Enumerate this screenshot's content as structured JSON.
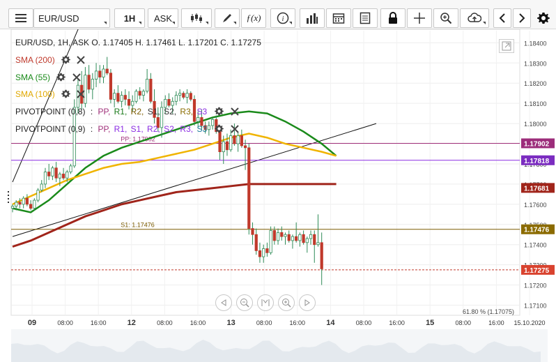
{
  "toolbar": {
    "symbol": "EUR/USD",
    "timeframe": "1H",
    "price_type": "ASK"
  },
  "header": {
    "ohlc": "EUR/USD, 1H, ASK   O. 1.17405 H. 1.17461 L. 1.17201 C. 1.17275"
  },
  "indicators": [
    {
      "label": "SMA (200)",
      "color": "#c0392b"
    },
    {
      "label": "SMA (55)",
      "color": "#1a8a1a"
    },
    {
      "label": "SMA (100)",
      "color": "#f0b400"
    }
  ],
  "pivots": [
    {
      "label": "PIVOTPOINT (0,8)",
      "items": [
        "PP,",
        "R1,",
        "R2,",
        "S1,",
        "S2,",
        "R3,",
        "S3"
      ]
    },
    {
      "label": "PIVOTPOINT (0,9)",
      "items": [
        "PP,",
        "R1,",
        "S1,",
        "R2,",
        "S2,",
        "R3,",
        "S3"
      ]
    }
  ],
  "chart_data": {
    "type": "line",
    "y_ticks": [
      1.184,
      1.183,
      1.182,
      1.181,
      1.18,
      1.179,
      1.178,
      1.177,
      1.176,
      1.175,
      1.174,
      1.173,
      1.172,
      1.171
    ],
    "y_tick_labels": [
      "1.18400",
      "1.18300",
      "1.18200",
      "1.18100",
      "1.18000",
      "1.17900",
      "1.17800",
      "1.17700",
      "1.17600",
      "1.17500",
      "1.17400",
      "1.17300",
      "1.17200",
      "1.17100"
    ],
    "ylim": [
      1.1705,
      1.1846
    ],
    "x_tick_labels": [
      "09",
      "08:00",
      "16:00",
      "12",
      "08:00",
      "16:00",
      "13",
      "08:00",
      "16:00",
      "14",
      "08:00",
      "16:00",
      "15",
      "08:00",
      "16:00",
      "15.10.2020"
    ],
    "x_tick_bold": [
      "09",
      "12",
      "13",
      "14",
      "15"
    ],
    "n_bars": 100,
    "candles": [
      [
        1.1758,
        1.176,
        1.1756,
        1.1759
      ],
      [
        1.1759,
        1.1762,
        1.1757,
        1.1761
      ],
      [
        1.1761,
        1.1763,
        1.1758,
        1.176
      ],
      [
        1.176,
        1.1764,
        1.1758,
        1.1763
      ],
      [
        1.1763,
        1.1765,
        1.1759,
        1.176
      ],
      [
        1.176,
        1.1762,
        1.1757,
        1.1758
      ],
      [
        1.1758,
        1.1763,
        1.1757,
        1.1762
      ],
      [
        1.1762,
        1.1768,
        1.1761,
        1.1767
      ],
      [
        1.1767,
        1.1772,
        1.1766,
        1.177
      ],
      [
        1.177,
        1.1778,
        1.1768,
        1.1776
      ],
      [
        1.1776,
        1.178,
        1.1772,
        1.1774
      ],
      [
        1.1774,
        1.1779,
        1.1772,
        1.1778
      ],
      [
        1.1778,
        1.1781,
        1.1771,
        1.1773
      ],
      [
        1.1773,
        1.1776,
        1.1769,
        1.1775
      ],
      [
        1.1775,
        1.1778,
        1.1772,
        1.1773
      ],
      [
        1.1773,
        1.1777,
        1.1771,
        1.1776
      ],
      [
        1.1776,
        1.178,
        1.1775,
        1.1779
      ],
      [
        1.1779,
        1.1812,
        1.1778,
        1.1808
      ],
      [
        1.1808,
        1.1822,
        1.1805,
        1.1819
      ],
      [
        1.1819,
        1.1826,
        1.1807,
        1.181
      ],
      [
        1.181,
        1.1828,
        1.1808,
        1.1824
      ],
      [
        1.1824,
        1.1829,
        1.1815,
        1.1817
      ],
      [
        1.1817,
        1.1825,
        1.1812,
        1.1822
      ],
      [
        1.1822,
        1.183,
        1.1818,
        1.1826
      ],
      [
        1.1826,
        1.1829,
        1.182,
        1.1823
      ],
      [
        1.1823,
        1.1829,
        1.182,
        1.1827
      ],
      [
        1.1827,
        1.1833,
        1.1824,
        1.1825
      ],
      [
        1.1825,
        1.1827,
        1.181,
        1.1812
      ],
      [
        1.1812,
        1.1817,
        1.1808,
        1.1815
      ],
      [
        1.1815,
        1.1819,
        1.181,
        1.1811
      ],
      [
        1.1811,
        1.1816,
        1.1808,
        1.1814
      ],
      [
        1.1814,
        1.1817,
        1.1809,
        1.1812
      ],
      [
        1.1812,
        1.1816,
        1.1807,
        1.1809
      ],
      [
        1.1809,
        1.1814,
        1.1806,
        1.1811
      ],
      [
        1.1811,
        1.1817,
        1.181,
        1.1816
      ],
      [
        1.1816,
        1.1818,
        1.1812,
        1.1814
      ],
      [
        1.1814,
        1.1817,
        1.1811,
        1.1816
      ],
      [
        1.1816,
        1.1827,
        1.1815,
        1.1822
      ],
      [
        1.1822,
        1.1825,
        1.181,
        1.1811
      ],
      [
        1.1811,
        1.1817,
        1.18,
        1.1803
      ],
      [
        1.1803,
        1.1808,
        1.1796,
        1.1798
      ],
      [
        1.1798,
        1.1811,
        1.1793,
        1.1808
      ],
      [
        1.1808,
        1.1814,
        1.1805,
        1.1812
      ],
      [
        1.1812,
        1.1815,
        1.1808,
        1.1809
      ],
      [
        1.1809,
        1.1813,
        1.1805,
        1.1811
      ],
      [
        1.1811,
        1.1816,
        1.1809,
        1.1814
      ],
      [
        1.1814,
        1.1817,
        1.1811,
        1.1815
      ],
      [
        1.1815,
        1.1816,
        1.1812,
        1.1813
      ],
      [
        1.1813,
        1.1817,
        1.181,
        1.1815
      ],
      [
        1.1815,
        1.1816,
        1.1811,
        1.1812
      ],
      [
        1.1812,
        1.1814,
        1.1799,
        1.1801
      ],
      [
        1.1801,
        1.1806,
        1.1798,
        1.1803
      ],
      [
        1.1803,
        1.1807,
        1.1797,
        1.1799
      ],
      [
        1.1799,
        1.1801,
        1.1795,
        1.1797
      ],
      [
        1.1797,
        1.1801,
        1.1794,
        1.1799
      ],
      [
        1.1799,
        1.1803,
        1.1797,
        1.1802
      ],
      [
        1.1802,
        1.1804,
        1.1795,
        1.1796
      ],
      [
        1.1796,
        1.1799,
        1.1782,
        1.1786
      ],
      [
        1.1786,
        1.1794,
        1.178,
        1.1791
      ],
      [
        1.1791,
        1.1795,
        1.1784,
        1.1787
      ],
      [
        1.1787,
        1.1797,
        1.1786,
        1.1794
      ],
      [
        1.1794,
        1.18,
        1.1789,
        1.179
      ],
      [
        1.179,
        1.1796,
        1.1786,
        1.1794
      ],
      [
        1.1794,
        1.1797,
        1.1788,
        1.1789
      ],
      [
        1.1789,
        1.1792,
        1.1777,
        1.1788
      ],
      [
        1.1788,
        1.179,
        1.1745,
        1.1748
      ],
      [
        1.1748,
        1.1751,
        1.174,
        1.1745
      ],
      [
        1.1745,
        1.1748,
        1.1735,
        1.1737
      ],
      [
        1.1737,
        1.1741,
        1.1731,
        1.1734
      ],
      [
        1.1734,
        1.174,
        1.1731,
        1.1738
      ],
      [
        1.1738,
        1.1741,
        1.1734,
        1.1736
      ],
      [
        1.1736,
        1.1749,
        1.1735,
        1.1747
      ],
      [
        1.1747,
        1.1749,
        1.174,
        1.1742
      ],
      [
        1.1742,
        1.1748,
        1.174,
        1.1746
      ],
      [
        1.1746,
        1.1749,
        1.1742,
        1.1744
      ],
      [
        1.1744,
        1.1746,
        1.174,
        1.1745
      ],
      [
        1.1745,
        1.1747,
        1.1741,
        1.1742
      ],
      [
        1.1742,
        1.1745,
        1.1738,
        1.1744
      ],
      [
        1.1744,
        1.1751,
        1.1741,
        1.1742
      ],
      [
        1.1742,
        1.1746,
        1.1739,
        1.1745
      ],
      [
        1.1745,
        1.1747,
        1.174,
        1.1741
      ],
      [
        1.1741,
        1.1744,
        1.1736,
        1.1743
      ],
      [
        1.1743,
        1.1747,
        1.174,
        1.1745
      ],
      [
        1.1745,
        1.1747,
        1.1731,
        1.174
      ],
      [
        1.174,
        1.1755,
        1.1739,
        1.1741
      ],
      [
        1.1741,
        1.1746,
        1.172,
        1.1728
      ]
    ],
    "series": [
      {
        "name": "SMA (55)",
        "values": [
          [
            0,
            1.1758
          ],
          [
            5,
            1.1756
          ],
          [
            10,
            1.1762
          ],
          [
            15,
            1.177
          ],
          [
            20,
            1.1778
          ],
          [
            25,
            1.1784
          ],
          [
            30,
            1.1788
          ],
          [
            35,
            1.1791
          ],
          [
            40,
            1.1794
          ],
          [
            45,
            1.1797
          ],
          [
            50,
            1.18
          ],
          [
            55,
            1.1803
          ],
          [
            60,
            1.1805
          ],
          [
            65,
            1.1806
          ],
          [
            70,
            1.1805
          ],
          [
            75,
            1.1801
          ],
          [
            80,
            1.1796
          ],
          [
            85,
            1.179
          ],
          [
            89,
            1.1784
          ]
        ]
      },
      {
        "name": "SMA (100)",
        "values": [
          [
            0,
            1.176
          ],
          [
            5,
            1.1764
          ],
          [
            10,
            1.1768
          ],
          [
            15,
            1.1772
          ],
          [
            20,
            1.1775
          ],
          [
            25,
            1.1778
          ],
          [
            30,
            1.178
          ],
          [
            35,
            1.1781
          ],
          [
            40,
            1.1783
          ],
          [
            45,
            1.1785
          ],
          [
            50,
            1.1787
          ],
          [
            55,
            1.179
          ],
          [
            60,
            1.1793
          ],
          [
            65,
            1.1795
          ],
          [
            70,
            1.1793
          ],
          [
            75,
            1.179
          ],
          [
            80,
            1.1788
          ],
          [
            85,
            1.1786
          ],
          [
            89,
            1.1784
          ]
        ]
      },
      {
        "name": "SMA (200)",
        "values": [
          [
            0,
            1.1739
          ],
          [
            5,
            1.1742
          ],
          [
            10,
            1.1746
          ],
          [
            15,
            1.175
          ],
          [
            20,
            1.1754
          ],
          [
            25,
            1.1757
          ],
          [
            30,
            1.176
          ],
          [
            35,
            1.1762
          ],
          [
            40,
            1.1764
          ],
          [
            45,
            1.1766
          ],
          [
            50,
            1.1767
          ],
          [
            55,
            1.1768
          ],
          [
            60,
            1.1769
          ],
          [
            65,
            1.177
          ],
          [
            70,
            1.177
          ],
          [
            75,
            1.177
          ],
          [
            80,
            1.177
          ],
          [
            85,
            1.177
          ],
          [
            89,
            1.177
          ]
        ]
      }
    ],
    "trendlines": [
      {
        "from": [
          0,
          1.1744
        ],
        "to": [
          100,
          1.18
        ]
      },
      {
        "from": [
          0,
          1.1771
        ],
        "to": [
          20,
          1.1855
        ]
      }
    ],
    "hlines": [
      {
        "value": 1.17902,
        "color": "#a0307a",
        "label": "PP: 1.17902",
        "label_at": 24
      },
      {
        "value": 1.17818,
        "color": "#8a2be2",
        "label": ""
      },
      {
        "value": 1.17476,
        "color": "#7b5b00",
        "label": "S1: 1.17476",
        "label_at": 24
      },
      {
        "value": 1.17275,
        "color": "#c0392b",
        "label": "",
        "dashed": true
      }
    ],
    "price_tags": [
      {
        "value": 1.17902,
        "label": "1.17902",
        "color": "#9c2d7a"
      },
      {
        "value": 1.17818,
        "label": "1.17818",
        "color": "#7b2cc0"
      },
      {
        "value": 1.17681,
        "label": "1.17681",
        "color": "#a0241a"
      },
      {
        "value": 1.17476,
        "label": "1.17476",
        "color": "#8b6b00"
      },
      {
        "value": 1.17275,
        "label": "1.17275",
        "color": "#d9432f"
      }
    ],
    "fib_label": "61.80 % (1.17075)"
  }
}
